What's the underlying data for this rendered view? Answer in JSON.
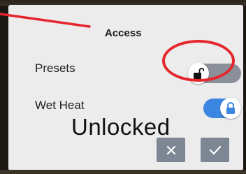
{
  "dialog": {
    "title": "Access",
    "settings": [
      {
        "label": "Presets",
        "state": "unlocked",
        "toggle_on": false
      },
      {
        "label": "Wet Heat",
        "state": "locked",
        "toggle_on": true
      }
    ],
    "actions": {
      "cancel_icon": "x-icon",
      "confirm_icon": "check-icon"
    }
  },
  "annotation": {
    "text": "Unlocked",
    "color": "#e5262d"
  },
  "colors": {
    "toggle_on": "#3a86e0",
    "toggle_off": "#8a8f99",
    "button": "#7d8693",
    "screen_bg": "#ececec"
  }
}
